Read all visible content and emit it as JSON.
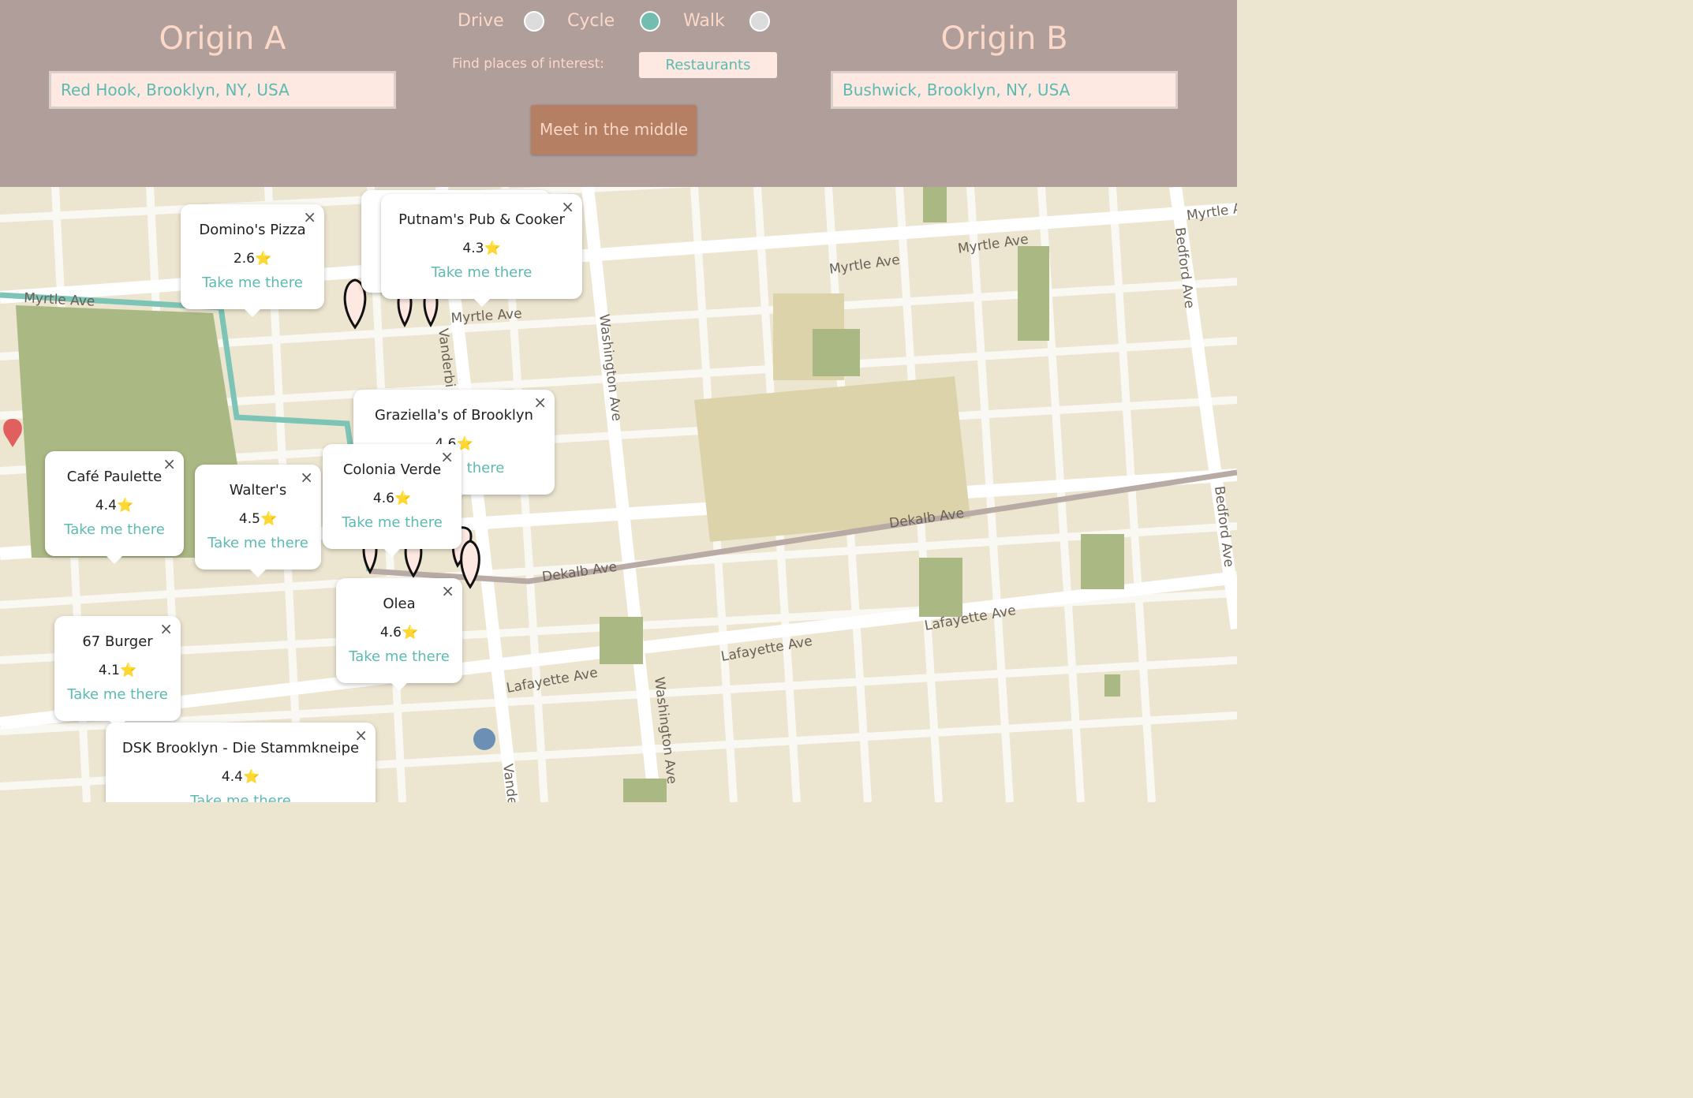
{
  "header": {
    "origin_a": {
      "title": "Origin A",
      "value": "Red Hook, Brooklyn, NY, USA"
    },
    "origin_b": {
      "title": "Origin B",
      "value": "Bushwick, Brooklyn, NY, USA"
    },
    "modes": [
      {
        "label": "Drive",
        "checked": false
      },
      {
        "label": "Cycle",
        "checked": true
      },
      {
        "label": "Walk",
        "checked": false
      }
    ],
    "find_label": "Find places of interest:",
    "category": "Restaurants",
    "meet_button": "Meet in the middle"
  },
  "map": {
    "streets": {
      "myrtle_1": "Myrtle Ave",
      "myrtle_2": "Myrtle Ave",
      "myrtle_3": "Myrtle Ave",
      "myrtle_4": "Myrtle Ave",
      "myrtle_5": "Myrtle A",
      "myrtle_6": "Myrtle Ave",
      "dekalb_1": "Dekalb Ave",
      "dekalb_2": "Dekalb Ave",
      "lafayette_1": "Lafayette Ave",
      "lafayette_2": "Lafayette Ave",
      "lafayette_3": "Lafayette Ave",
      "washington_1": "Washington Ave",
      "washington_2": "Washington Ave",
      "bedford_1": "Bedford Ave",
      "bedford_2": "Bedford Ave",
      "vanderbilt_1": "Vanderbi",
      "vanderbilt_2": "Vande"
    },
    "colors": {
      "route": "#7cc4b6",
      "route_b": "#b8aaa4",
      "park": "#aab883",
      "water_h": "#e06060"
    },
    "close_symbol": "×",
    "star": "⭐",
    "popups": [
      {
        "name": "Domino's Pizza",
        "rating": "2.6",
        "link": "Take me there"
      },
      {
        "name": "Putnam's Pub & Cooker",
        "rating": "4.3",
        "link": "Take me there"
      },
      {
        "name": "Graziella's of Brooklyn",
        "rating": "4.6",
        "link": "Take me there"
      },
      {
        "name": "Café Paulette",
        "rating": "4.4",
        "link": "Take me there"
      },
      {
        "name": "Walter's",
        "rating": "4.5",
        "link": "Take me there"
      },
      {
        "name": "Colonia Verde",
        "rating": "4.6",
        "link": "Take me there"
      },
      {
        "name": "Olea",
        "rating": "4.6",
        "link": "Take me there"
      },
      {
        "name": "67 Burger",
        "rating": "4.1",
        "link": "Take me there"
      },
      {
        "name": "DSK Brooklyn - Die Stammkneipe",
        "rating": "4.4",
        "link": "Take me there"
      }
    ]
  }
}
